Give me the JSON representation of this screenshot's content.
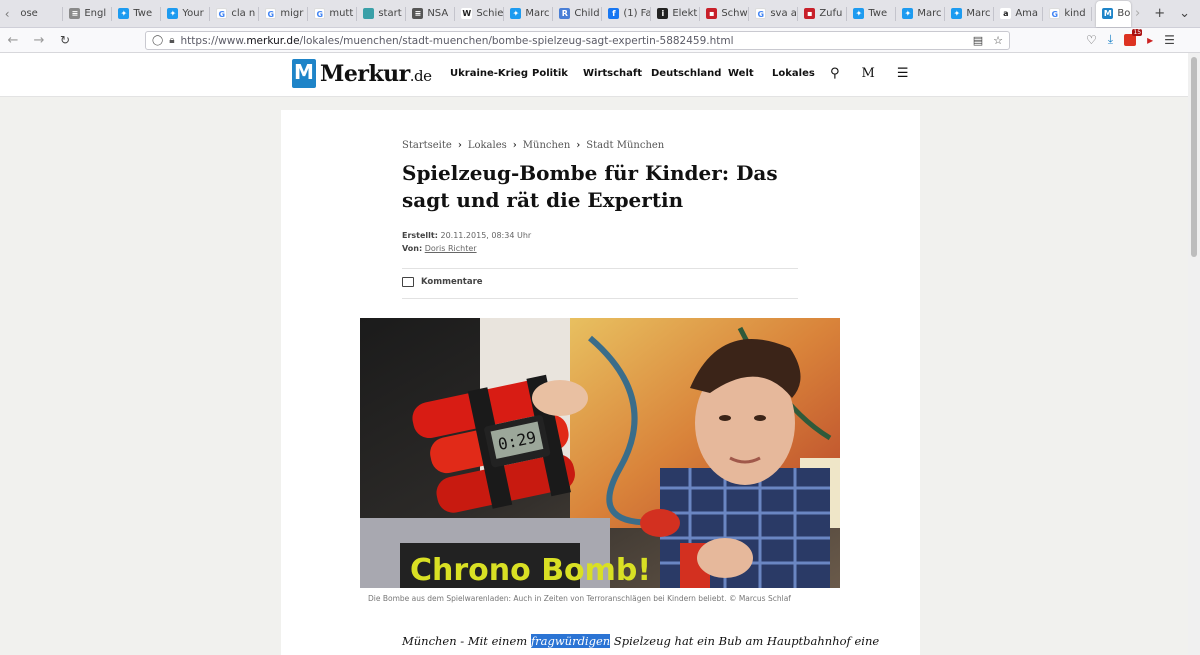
{
  "browser": {
    "tabs": [
      {
        "label": "ose",
        "favicon": "",
        "color": "#ffffff"
      },
      {
        "label": "Engl",
        "favicon": "doc",
        "color": "#8a8a8a"
      },
      {
        "label": "Twe",
        "favicon": "twitter",
        "color": "#1d9bf0"
      },
      {
        "label": "Your",
        "favicon": "twitter",
        "color": "#1d9bf0"
      },
      {
        "label": "cla n",
        "favicon": "G",
        "color": "#4285f4"
      },
      {
        "label": "migr",
        "favicon": "G",
        "color": "#4285f4"
      },
      {
        "label": "mutt",
        "favicon": "G",
        "color": "#4285f4"
      },
      {
        "label": "start",
        "favicon": "square",
        "color": "#3aa0a8"
      },
      {
        "label": "NSA",
        "favicon": "flag",
        "color": "#555555"
      },
      {
        "label": "Schie",
        "favicon": "W",
        "color": "#333333"
      },
      {
        "label": "Marc",
        "favicon": "twitter",
        "color": "#1d9bf0"
      },
      {
        "label": "Child",
        "favicon": "R",
        "color": "#4a7fd6"
      },
      {
        "label": "(1) Fa",
        "favicon": "f",
        "color": "#1877f2"
      },
      {
        "label": "Elekt",
        "favicon": "i",
        "color": "#222222"
      },
      {
        "label": "Schw",
        "favicon": "box",
        "color": "#c8202a"
      },
      {
        "label": "sva a",
        "favicon": "G",
        "color": "#4285f4"
      },
      {
        "label": "Zufu",
        "favicon": "box",
        "color": "#c8202a"
      },
      {
        "label": "Twe",
        "favicon": "twitter",
        "color": "#1d9bf0"
      },
      {
        "label": "Marc",
        "favicon": "twitter",
        "color": "#1d9bf0"
      },
      {
        "label": "Marc",
        "favicon": "twitter",
        "color": "#1d9bf0"
      },
      {
        "label": "Ama",
        "favicon": "a",
        "color": "#222222"
      },
      {
        "label": "kind",
        "favicon": "G",
        "color": "#4285f4"
      }
    ],
    "active_tab": {
      "label": "Bo",
      "favicon": "M",
      "color": "#1e84c8"
    },
    "url_prefix": "https://www.",
    "url_host": "merkur.de",
    "url_path": "/lokales/muenchen/stadt-muenchen/bombe-spielzeug-sagt-expertin-5882459.html"
  },
  "site": {
    "logo_text": "Merkur",
    "logo_suffix": ".de",
    "nav": [
      "Ukraine-Krieg",
      "Politik",
      "Wirtschaft",
      "Deutschland",
      "Welt",
      "Lokales"
    ],
    "accent": "#1e84c8"
  },
  "article": {
    "breadcrumb": [
      "Startseite",
      "Lokales",
      "München",
      "Stadt München"
    ],
    "headline": "Spielzeug-Bombe für Kinder: Das sagt und rät die Expertin",
    "created_label": "Erstellt:",
    "created_value": "20.11.2015, 08:34 Uhr",
    "author_label": "Von:",
    "author": "Doris Richter",
    "comments_label": "Kommentare",
    "caption": "Die Bombe aus dem Spielwarenladen: Auch in Zeiten von Terroranschlägen bei Kindern beliebt. © Marcus Schlaf",
    "photo_toy_display": "0:29",
    "photo_box_text": "Chrono Bomb!",
    "lead_before": "München - Mit einem ",
    "lead_highlight": "fragwürdigen",
    "lead_after": " Spielzeug hat ein Bub am Hauptbahnhof eine"
  }
}
